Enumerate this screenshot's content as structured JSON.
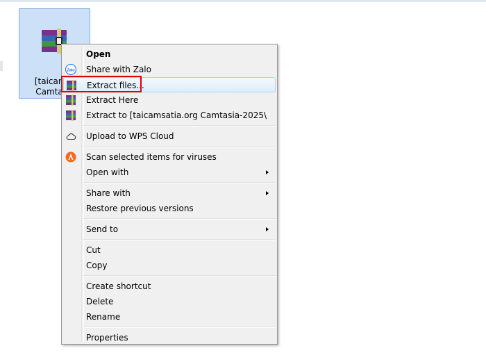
{
  "file": {
    "label_line1": "[taicamsa",
    "label_line2": "Camtasia",
    "icon": "winrar-archive-icon"
  },
  "menu": {
    "open": "Open",
    "share_zalo": "Share with Zalo",
    "zalo_badge": "Zalo",
    "extract_files": "Extract files...",
    "extract_here": "Extract Here",
    "extract_to": "Extract to [taicamsatia.org Camtasia-2025\\",
    "upload_wps": "Upload to WPS Cloud",
    "scan_viruses": "Scan selected items for viruses",
    "open_with": "Open with",
    "share_with": "Share with",
    "restore_versions": "Restore previous versions",
    "send_to": "Send to",
    "cut": "Cut",
    "copy": "Copy",
    "create_shortcut": "Create shortcut",
    "delete": "Delete",
    "rename": "Rename",
    "properties": "Properties"
  },
  "colors": {
    "menu_bg": "#f0f0f0",
    "selection_bg": "#cce0f7",
    "highlight_border": "#e00000",
    "avast_orange": "#f26b21",
    "zalo_blue": "#0a68fe"
  }
}
